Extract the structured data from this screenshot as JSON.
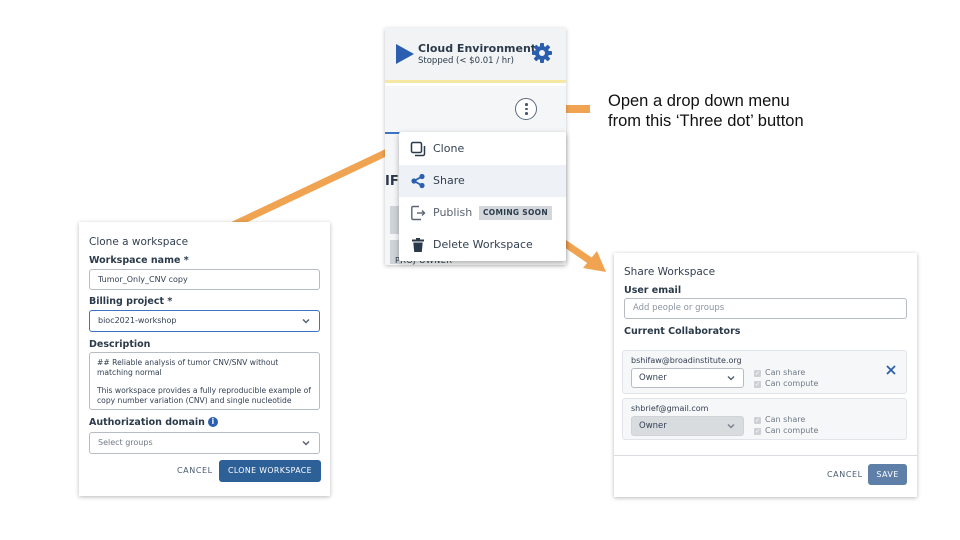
{
  "colors": {
    "arrow": "#f0a350",
    "accent": "#2e6098",
    "play": "#2a5fb0"
  },
  "cloud_env": {
    "title": "Cloud Environment",
    "status": "Stopped (< $0.01 / hr)"
  },
  "background": {
    "heading_fragment": "IF",
    "table_text": "PROJ OWNER"
  },
  "menu": {
    "items": [
      {
        "label": "Clone",
        "icon": "clone-icon"
      },
      {
        "label": "Share",
        "icon": "share-icon"
      },
      {
        "label": "Publish",
        "icon": "publish-icon",
        "badge": "COMING SOON"
      },
      {
        "label": "Delete Workspace",
        "icon": "trash-icon"
      }
    ]
  },
  "annotation": {
    "line1": "Open a drop down menu",
    "line2": "from this ‘Three dot’ button"
  },
  "clone_dialog": {
    "title": "Clone a workspace",
    "workspace_name_label": "Workspace name *",
    "workspace_name_value": "Tumor_Only_CNV copy",
    "billing_label": "Billing project *",
    "billing_value": "bioc2021-workshop",
    "description_label": "Description",
    "description_line1": "## Reliable analysis of tumor CNV/SNV without matching normal",
    "description_line2": "This workspace provides a fully reproducible example of copy number variation (CNV) and single nucleotide",
    "auth_label": "Authorization domain",
    "auth_placeholder": "Select groups",
    "cancel_label": "CANCEL",
    "clone_label": "CLONE WORKSPACE"
  },
  "share_dialog": {
    "title": "Share Workspace",
    "email_label": "User email",
    "email_placeholder": "Add people or groups",
    "collaborators_label": "Current Collaborators",
    "collaborators": [
      {
        "email": "bshifaw@broadinstitute.org",
        "role": "Owner",
        "can_share": "Can share",
        "can_compute": "Can compute"
      },
      {
        "email": "shbrief@gmail.com",
        "role": "Owner",
        "can_share": "Can share",
        "can_compute": "Can compute"
      }
    ],
    "cancel_label": "CANCEL",
    "save_label": "SAVE"
  }
}
